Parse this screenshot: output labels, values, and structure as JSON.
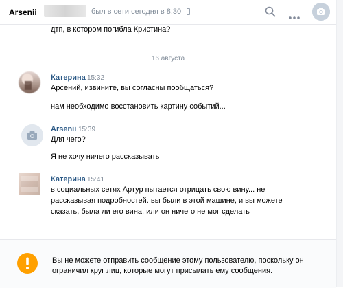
{
  "header": {
    "contact_name": "Arsenii",
    "status": "был в сети сегодня в 8:30"
  },
  "previous_message": {
    "text": "дтп, в котором погибла Кристина?"
  },
  "date_separator": "16 августа",
  "messages": [
    {
      "author": "Катерина",
      "time": "15:32",
      "lines": [
        "Арсений, извините, вы согласны пообщаться?",
        "нам необходимо восстановить картину событий..."
      ]
    },
    {
      "author": "Arsenii",
      "time": "15:39",
      "lines": [
        "Для чего?",
        "Я не хочу ничего рассказывать"
      ]
    },
    {
      "author": "Катерина",
      "time": "15:41",
      "lines": [
        "в социальных сетях Артур пытается отрицать свою вину... не",
        "рассказывая подробностей. вы были в этой машине, и вы можете",
        "сказать, была ли его вина, или он ничего не мог сделать"
      ]
    }
  ],
  "footer": {
    "notice_line1": "Вы не можете отправить сообщение этому пользователю, поскольку он",
    "notice_line2": "ограничил круг лиц, которые могут присылать ему сообщения.",
    "icon": "exclamation-icon"
  },
  "colors": {
    "link": "#2a5885",
    "muted": "#818c99",
    "warning": "#ffa000"
  }
}
